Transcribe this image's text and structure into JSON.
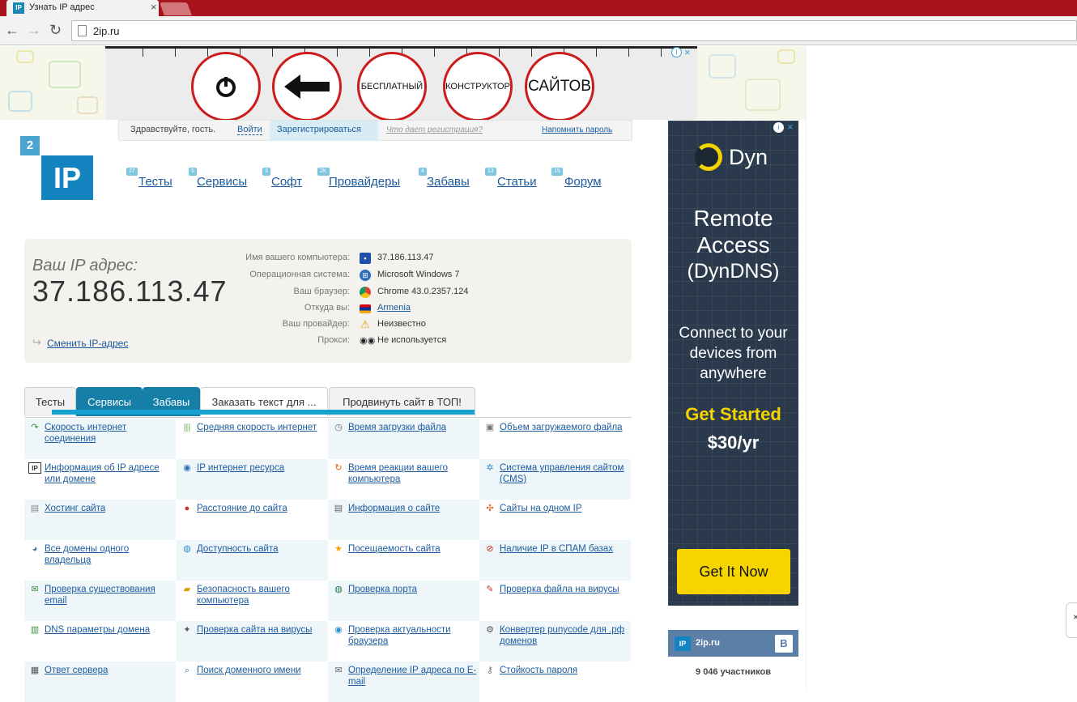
{
  "browser": {
    "tab_title": "Узнать IP адрес",
    "tab_favicon": "IP",
    "tab_close": "×",
    "url": "2ip.ru",
    "back_icon": "←",
    "forward_icon": "→",
    "reload_icon": "↻"
  },
  "top_ad": {
    "words": [
      "БЕСПЛАТНЫЙ",
      "КОНСТРУКТОР",
      "САЙТОВ"
    ],
    "info_icon": "i",
    "close_icon": "×"
  },
  "login": {
    "greeting": "Здравствуйте, гость.",
    "login_link": "Войти",
    "register_link": "Зарегистрироваться",
    "why_link": "Что дает регистрация?",
    "remind_link": "Напомнить пароль"
  },
  "logo": {
    "small": "2",
    "big": "IP"
  },
  "nav": [
    {
      "label": "Тесты",
      "badge": "27"
    },
    {
      "label": "Сервисы",
      "badge": "5"
    },
    {
      "label": "Софт",
      "badge": "3"
    },
    {
      "label": "Провайдеры",
      "badge": "2K"
    },
    {
      "label": "Забавы",
      "badge": "4"
    },
    {
      "label": "Статьи",
      "badge": "13"
    },
    {
      "label": "Форум",
      "badge": "15"
    }
  ],
  "ip_panel": {
    "label": "Ваш IP адрес:",
    "value": "37.186.113.47",
    "change_link": "Сменить IP-адрес",
    "rows": [
      {
        "key": "Имя вашего компьютера:",
        "value": "37.186.113.47",
        "icon": "computer-icon",
        "link": false
      },
      {
        "key": "Операционная система:",
        "value": "Microsoft Windows 7",
        "icon": "windows-icon",
        "link": false
      },
      {
        "key": "Ваш браузер:",
        "value": "Chrome 43.0.2357.124",
        "icon": "chrome-icon",
        "link": false
      },
      {
        "key": "Откуда вы:",
        "value": "Armenia",
        "icon": "flag-icon",
        "link": true
      },
      {
        "key": "Ваш провайдер:",
        "value": "Неизвестно",
        "icon": "warning-icon",
        "link": false
      },
      {
        "key": "Прокси:",
        "value": "Не используется",
        "icon": "glasses-icon",
        "link": false
      }
    ]
  },
  "tabs": [
    {
      "label": "Тесты"
    },
    {
      "label": "Сервисы"
    },
    {
      "label": "Забавы"
    },
    {
      "label": "Заказать текст для ..."
    },
    {
      "label": "Продвинуть сайт в ТОП!"
    }
  ],
  "services": [
    {
      "label": "Скорость интернет соединения",
      "icon": "speed-arrow-icon"
    },
    {
      "label": "Средняя скорость интернет",
      "icon": "bars-icon"
    },
    {
      "label": "Время загрузки файла",
      "icon": "clock-icon"
    },
    {
      "label": "Объем загружаемого файла",
      "icon": "file-size-icon"
    },
    {
      "label": "Информация об IP адресе или домене",
      "icon": "ip-info-icon"
    },
    {
      "label": "IP интернет ресурса",
      "icon": "globe-ip-icon"
    },
    {
      "label": "Время реакции вашего компьютера",
      "icon": "reaction-icon"
    },
    {
      "label": "Система управления сайтом (CMS)",
      "icon": "cms-gear-icon"
    },
    {
      "label": "Хостинг сайта",
      "icon": "server-icon"
    },
    {
      "label": "Расстояние до сайта",
      "icon": "pin-icon"
    },
    {
      "label": "Информация о сайте",
      "icon": "document-icon"
    },
    {
      "label": "Сайты на одном IP",
      "icon": "network-icon"
    },
    {
      "label": "Все домены одного владельца",
      "icon": "owner-icon"
    },
    {
      "label": "Доступность сайта",
      "icon": "availability-icon"
    },
    {
      "label": "Посещаемость сайта",
      "icon": "star-icon"
    },
    {
      "label": "Наличие IP в СПАМ базах",
      "icon": "spam-icon"
    },
    {
      "label": "Проверка существования email",
      "icon": "email-icon"
    },
    {
      "label": "Безопасность вашего компьютера",
      "icon": "lock-icon"
    },
    {
      "label": "Проверка порта",
      "icon": "port-icon"
    },
    {
      "label": "Проверка файла на вирусы",
      "icon": "virus-file-icon"
    },
    {
      "label": "DNS параметры домена",
      "icon": "dns-icon"
    },
    {
      "label": "Проверка сайта на вирусы",
      "icon": "virus-site-icon"
    },
    {
      "label": "Проверка актуальности браузера",
      "icon": "browser-update-icon"
    },
    {
      "label": "Конвертер punycode для .рф доменов",
      "icon": "converter-icon"
    },
    {
      "label": "Ответ сервера",
      "icon": "server-response-icon"
    },
    {
      "label": "Поиск доменного имени",
      "icon": "domain-search-icon"
    },
    {
      "label": "Определение IP адреса по E-mail",
      "icon": "email-ip-icon"
    },
    {
      "label": "Стойкость пароля",
      "icon": "key-icon"
    }
  ],
  "right_ad": {
    "brand": "Dyn",
    "headline": "Remote Access",
    "sub": "(DynDNS)",
    "tagline": "Connect to your devices from anywhere",
    "cta_text": "Get Started",
    "price": "$30/yr",
    "button": "Get It Now",
    "info_icon": "i",
    "close_icon": "×",
    "accent": "#f5d400"
  },
  "vk": {
    "logo": "IP",
    "name": "2ip.ru",
    "vk_icon": "B",
    "members": "9 046 участников"
  },
  "colors": {
    "brand_blue": "#1384c0",
    "link": "#1c5b9e",
    "tab_blue": "#157fa8",
    "browser_red": "#a7131a"
  }
}
